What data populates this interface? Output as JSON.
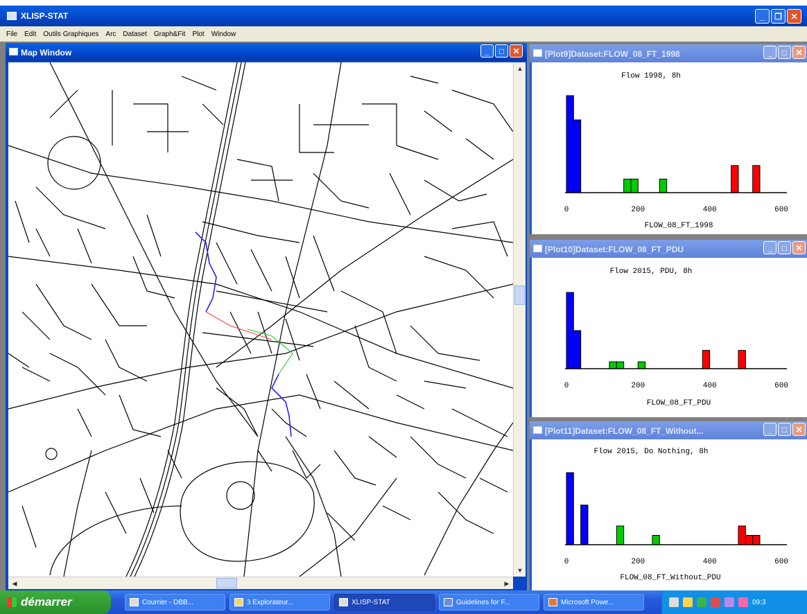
{
  "app": {
    "title": "XLISP-STAT"
  },
  "menu": [
    "File",
    "Edit",
    "Outils Graphiques",
    "Arc",
    "Dataset",
    "Graph&Fit",
    "Plot",
    "Window"
  ],
  "map_window": {
    "title": "Map Window"
  },
  "plots": [
    {
      "window_title": "[Plot9]Dataset:FLOW_08_FT_1998",
      "title": "Flow 1998, 8h",
      "xlabel": "FLOW_08_FT_1998",
      "ticks": [
        "0",
        "200",
        "400",
        "600"
      ]
    },
    {
      "window_title": "[Plot10]Dataset:FLOW_08_FT_PDU",
      "title": "Flow 2015, PDU, 8h",
      "xlabel": "FLOW_08_FT_PDU",
      "ticks": [
        "0",
        "200",
        "400",
        "600"
      ]
    },
    {
      "window_title": "[Plot11]Dataset:FLOW_08_FT_Without...",
      "title": "Flow 2015, Do Nothing, 8h",
      "xlabel": "FLOW_08_FT_Without_PDU",
      "ticks": [
        "0",
        "200",
        "400",
        "600"
      ]
    }
  ],
  "chart_data": [
    {
      "type": "bar",
      "title": "Flow 1998, 8h",
      "xlabel": "FLOW_08_FT_1998",
      "xlim": [
        0,
        600
      ],
      "bin_width": 20,
      "series": [
        {
          "color": "#0000ff",
          "bins": [
            [
              0,
              100
            ],
            [
              20,
              75
            ]
          ]
        },
        {
          "color": "#00cc00",
          "bins": [
            [
              160,
              14
            ],
            [
              180,
              14
            ],
            [
              260,
              14
            ]
          ]
        },
        {
          "color": "#ff0000",
          "bins": [
            [
              460,
              28
            ],
            [
              520,
              28
            ]
          ]
        }
      ]
    },
    {
      "type": "bar",
      "title": "Flow 2015, PDU, 8h",
      "xlabel": "FLOW_08_FT_PDU",
      "xlim": [
        0,
        600
      ],
      "bin_width": 20,
      "series": [
        {
          "color": "#0000ff",
          "bins": [
            [
              0,
              100
            ],
            [
              20,
              50
            ]
          ]
        },
        {
          "color": "#00cc00",
          "bins": [
            [
              120,
              9
            ],
            [
              140,
              9
            ],
            [
              200,
              9
            ]
          ]
        },
        {
          "color": "#ff0000",
          "bins": [
            [
              380,
              24
            ],
            [
              480,
              24
            ]
          ]
        }
      ]
    },
    {
      "type": "bar",
      "title": "Flow 2015, Do Nothing, 8h",
      "xlabel": "FLOW_08_FT_Without_PDU",
      "xlim": [
        0,
        600
      ],
      "bin_width": 20,
      "series": [
        {
          "color": "#0000ff",
          "bins": [
            [
              0,
              100
            ],
            [
              40,
              55
            ]
          ]
        },
        {
          "color": "#00cc00",
          "bins": [
            [
              140,
              26
            ],
            [
              240,
              13
            ]
          ]
        },
        {
          "color": "#ff0000",
          "bins": [
            [
              480,
              26
            ],
            [
              500,
              13
            ],
            [
              520,
              13
            ]
          ]
        }
      ]
    }
  ],
  "taskbar": {
    "start": "démarrer",
    "tasks": [
      "Courrier - DBB...",
      "3 Explorateur...",
      "XLISP-STAT",
      "Guidelines for F...",
      "Microsoft Powe..."
    ],
    "clock": "09:3"
  }
}
